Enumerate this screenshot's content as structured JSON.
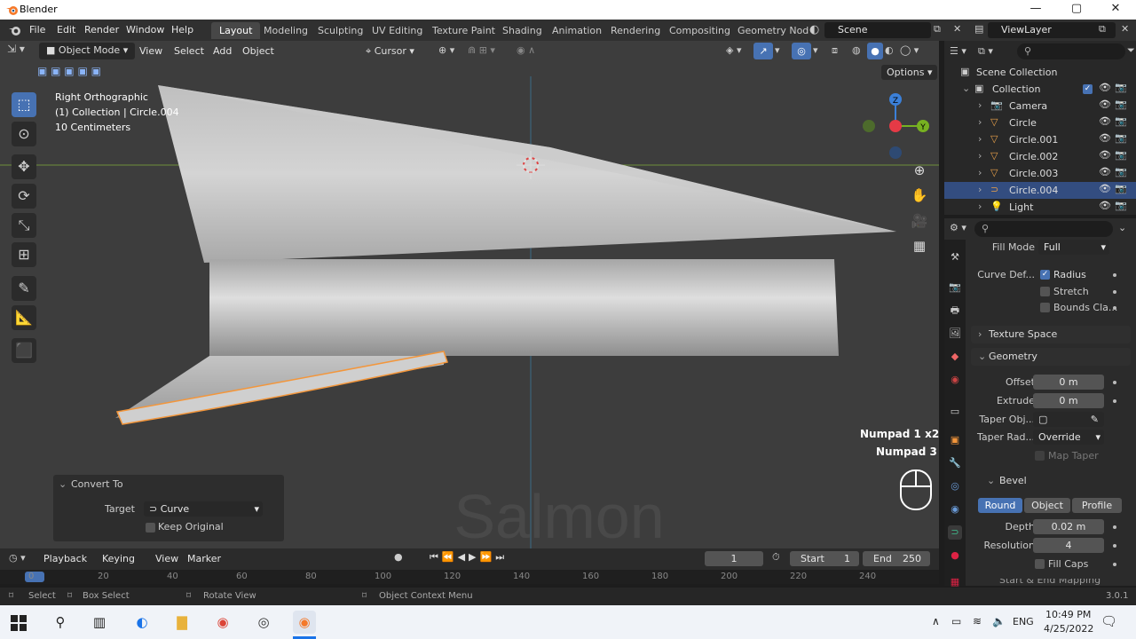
{
  "window": {
    "title": "Blender",
    "min": "—",
    "max": "▢",
    "close": "✕"
  },
  "menu": [
    "File",
    "Edit",
    "Render",
    "Window",
    "Help"
  ],
  "workspaces": [
    "Layout",
    "Modeling",
    "Sculpting",
    "UV Editing",
    "Texture Paint",
    "Shading",
    "Animation",
    "Rendering",
    "Compositing",
    "Geometry Nod"
  ],
  "scene": {
    "label": "Scene",
    "viewlayer": "ViewLayer"
  },
  "viewport_header": {
    "mode": "Object Mode",
    "items": [
      "View",
      "Select",
      "Add",
      "Object"
    ],
    "pivot": "Cursor",
    "options": "Options"
  },
  "viewport_overlay": {
    "view_name": "Right Orthographic",
    "collection": "(1) Collection | Circle.004",
    "scale": "10 Centimeters",
    "key1": "Numpad 1 x2",
    "key2": "Numpad 3",
    "watermark": "Salmon"
  },
  "gizmo": {
    "z": "Z",
    "y": "Y"
  },
  "operator_panel": {
    "title": "Convert To",
    "target_label": "Target",
    "target_value": "Curve",
    "keep_original": "Keep Original"
  },
  "timeline": {
    "items": [
      "Playback",
      "Keying",
      "View",
      "Marker"
    ],
    "current": "1",
    "start_label": "Start",
    "start": "1",
    "end_label": "End",
    "end": "250",
    "ruler": [
      "0",
      "20",
      "40",
      "60",
      "80",
      "100",
      "120",
      "140",
      "160",
      "180",
      "200",
      "220",
      "240"
    ]
  },
  "status": {
    "select": "Select",
    "box": "Box Select",
    "rotate": "Rotate View",
    "context": "Object Context Menu",
    "version": "3.0.1"
  },
  "outliner": {
    "root": "Scene Collection",
    "collection": "Collection",
    "items": [
      {
        "name": "Camera",
        "icon": "camera-icon",
        "color": "#e8a04a"
      },
      {
        "name": "Circle",
        "icon": "mesh-icon",
        "color": "#e8a04a"
      },
      {
        "name": "Circle.001",
        "icon": "mesh-icon",
        "color": "#e8a04a"
      },
      {
        "name": "Circle.002",
        "icon": "mesh-icon",
        "color": "#e8a04a"
      },
      {
        "name": "Circle.003",
        "icon": "mesh-icon",
        "color": "#e8a04a"
      },
      {
        "name": "Circle.004",
        "icon": "curve-icon",
        "color": "#e8a04a",
        "selected": true
      },
      {
        "name": "Light",
        "icon": "light-icon",
        "color": "#e8a04a"
      }
    ]
  },
  "properties": {
    "fill_mode_label": "Fill Mode",
    "fill_mode": "Full",
    "curve_def_label": "Curve Def...",
    "radius": "Radius",
    "stretch": "Stretch",
    "bounds": "Bounds Cla...",
    "texture_space": "Texture Space",
    "geometry": "Geometry",
    "offset_label": "Offset",
    "offset": "0 m",
    "extrude_label": "Extrude",
    "extrude": "0 m",
    "taper_obj_label": "Taper Obj...",
    "taper_rad_label": "Taper Rad...",
    "taper_rad": "Override",
    "map_taper": "Map Taper",
    "bevel": "Bevel",
    "bevel_modes": [
      "Round",
      "Object",
      "Profile"
    ],
    "depth_label": "Depth",
    "depth": "0.02 m",
    "resolution_label": "Resolution",
    "resolution": "4",
    "fill_caps": "Fill Caps",
    "start_end": "Start & End Mapping"
  },
  "taskbar": {
    "lang": "ENG",
    "time": "10:49 PM",
    "date": "4/25/2022"
  },
  "colors": {
    "accent": "#4772b3",
    "selection": "#f3963b",
    "x_axis": "#e53a46",
    "y_axis": "#77b121",
    "z_axis": "#3b80d9"
  }
}
